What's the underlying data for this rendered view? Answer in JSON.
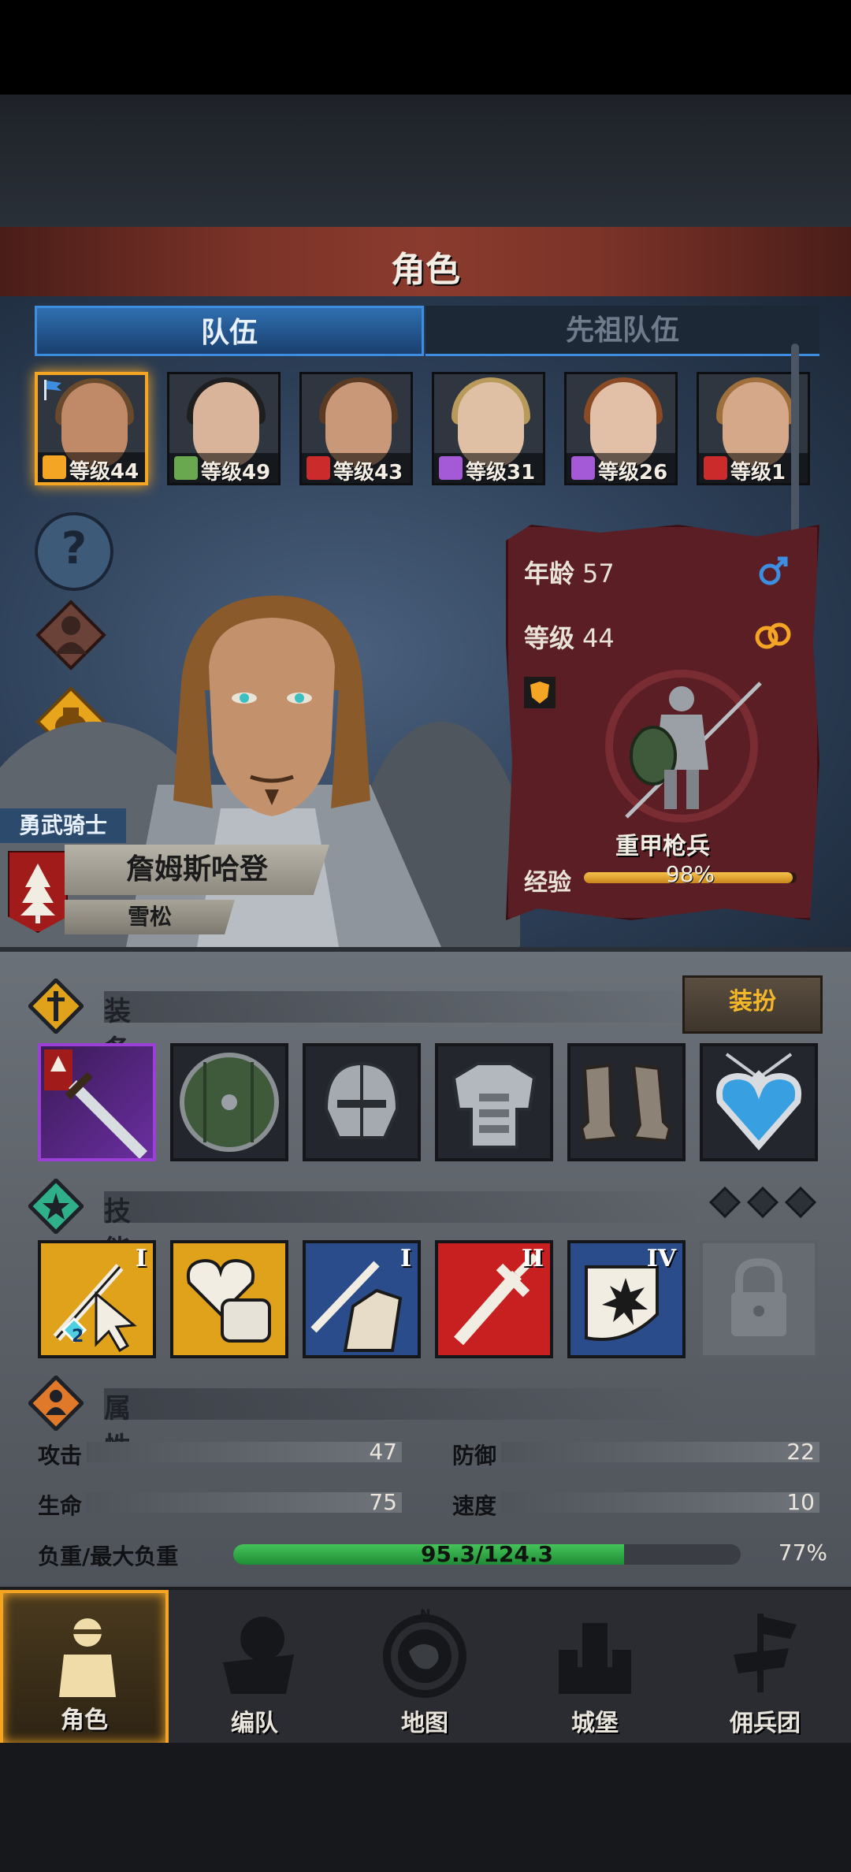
{
  "header": {
    "title": "角色"
  },
  "tabs": [
    {
      "label": "队伍"
    },
    {
      "label": "先祖队伍"
    }
  ],
  "roster": [
    {
      "level": "等级44",
      "class_icon": "shield-icon",
      "icon_color": "#f4a523",
      "skin": "#c08a68",
      "hair": "#6a4a2c",
      "flag": "flag-icon"
    },
    {
      "level": "等级49",
      "class_icon": "bow-icon",
      "icon_color": "#6aa84f",
      "skin": "#d9b49a",
      "hair": "#1f1f1f"
    },
    {
      "level": "等级43",
      "class_icon": "boot-icon",
      "icon_color": "#cc2b2b",
      "skin": "#c99878",
      "hair": "#5a3a22"
    },
    {
      "level": "等级31",
      "class_icon": "staff-icon",
      "icon_color": "#a45ad6",
      "skin": "#e0c0a4",
      "hair": "#b89a5a"
    },
    {
      "level": "等级26",
      "class_icon": "staff-icon",
      "icon_color": "#a45ad6",
      "skin": "#e2c0a8",
      "hair": "#8a4a24"
    },
    {
      "level": "等级1",
      "class_icon": "boot-icon",
      "icon_color": "#cc2b2b",
      "skin": "#d4a888",
      "hair": "#a0703c"
    }
  ],
  "hero": {
    "class_title": "勇武骑士",
    "name": "詹姆斯哈登",
    "house": "雪松",
    "age_label": "年龄",
    "age": "57",
    "level_label": "等级",
    "level": "44",
    "unit_type": "重甲枪兵",
    "exp_label": "经验",
    "exp_pct": "98%",
    "exp_fraction": 0.98
  },
  "equipment": {
    "title": "装备",
    "dress_button": "装扮",
    "slots": [
      "sword-icon",
      "round-shield-icon",
      "helmet-icon",
      "plate-armor-icon",
      "boots-icon",
      "heart-amulet-icon"
    ]
  },
  "skills": {
    "title": "技能",
    "items": [
      {
        "icon": "sword-cursor-icon",
        "rank": "I",
        "bg": "#e0a21a",
        "badge": "2"
      },
      {
        "icon": "heart-fist-icon",
        "rank": "",
        "bg": "#e0a21a"
      },
      {
        "icon": "hand-sword-icon",
        "rank": "I",
        "bg": "#2a4c8a"
      },
      {
        "icon": "red-sword-icon",
        "rank": "II",
        "bg": "#c82020"
      },
      {
        "icon": "burst-shield-icon",
        "rank": "IV",
        "bg": "#2a4c8a"
      }
    ],
    "locked_icon": "padlock-icon"
  },
  "attributes": {
    "title": "属性",
    "attack_label": "攻击",
    "attack": "47",
    "defense_label": "防御",
    "defense": "22",
    "hp_label": "生命",
    "hp": "75",
    "speed_label": "速度",
    "speed": "10",
    "load_label": "负重/最大负重",
    "load_value": "95.3/124.3",
    "load_pct": "77%",
    "load_fraction": 0.77
  },
  "nav": [
    {
      "label": "角色",
      "icon": "knight-icon"
    },
    {
      "label": "编队",
      "icon": "formation-icon"
    },
    {
      "label": "地图",
      "icon": "compass-map-icon"
    },
    {
      "label": "城堡",
      "icon": "castle-icon"
    },
    {
      "label": "佣兵团",
      "icon": "mercenary-icon"
    }
  ],
  "colors": {
    "accent": "#f4a523",
    "tab_blue": "#3d8de0",
    "card_red": "#5b1e24",
    "load_green": "#2ea843"
  }
}
